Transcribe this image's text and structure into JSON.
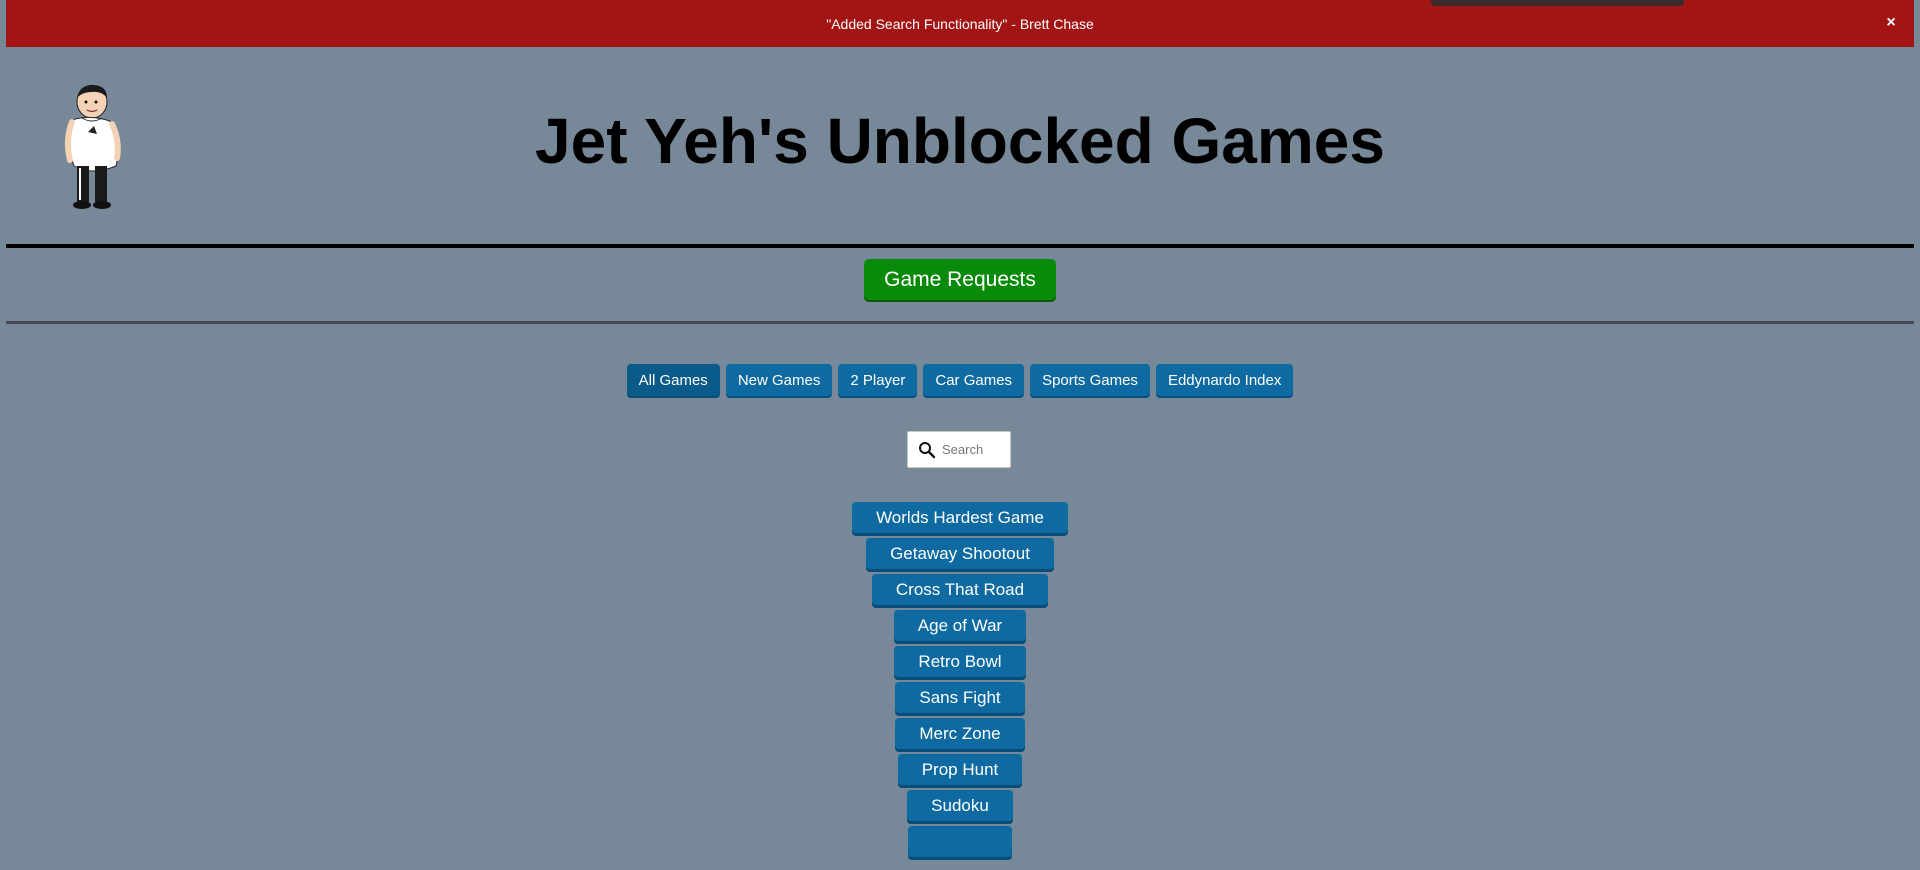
{
  "banner": {
    "text": "\"Added Search Functionality\" - Brett Chase",
    "close_glyph": "×"
  },
  "header": {
    "title": "Jet Yeh's Unblocked Games",
    "mascot_icon": "cartoon-man-mascot"
  },
  "requests": {
    "label": "Game Requests",
    "color": "#0a8a0a"
  },
  "categories": [
    {
      "label": "All Games",
      "active": true
    },
    {
      "label": "New Games",
      "active": false
    },
    {
      "label": "2 Player",
      "active": false
    },
    {
      "label": "Car Games",
      "active": false
    },
    {
      "label": "Sports Games",
      "active": false
    },
    {
      "label": "Eddynardo Index",
      "active": false
    }
  ],
  "search": {
    "placeholder": "Search",
    "value": "",
    "icon": "search-icon"
  },
  "games": [
    "Worlds Hardest Game",
    "Getaway Shootout",
    "Cross That Road",
    "Age of War",
    "Retro Bowl",
    "Sans Fight",
    "Merc Zone",
    "Prop Hunt",
    "Sudoku",
    ""
  ],
  "colors": {
    "background": "#778899",
    "banner": "#a31515",
    "button": "#0e6aa0"
  }
}
